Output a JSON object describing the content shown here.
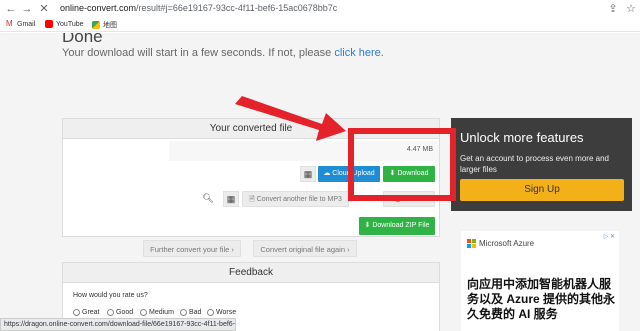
{
  "browser": {
    "url_host": "online-convert.com",
    "url_path": "/result#j=66e19167-93cc-4f11-bef6-15ac0678bb7c",
    "bookmarks": [
      {
        "label": "Gmail"
      },
      {
        "label": "YouTube"
      },
      {
        "label": "地图"
      }
    ]
  },
  "page": {
    "title": "Done",
    "subtitle_prefix": "Your download will start in a few seconds. If not, please ",
    "subtitle_link": "click here",
    "subtitle_suffix": "."
  },
  "converted": {
    "heading": "Your converted file",
    "file_size": "4.47 MB",
    "cloud_upload_label": "Cloud Upload",
    "download_label": "Download",
    "convert_another_label": "Convert another file to MP3",
    "delete_label": "Delete",
    "download_zip_label": "Download ZIP File"
  },
  "further": {
    "further_convert_label": "Further convert your file ›",
    "convert_original_label": "Convert original file again ›"
  },
  "feedback": {
    "heading": "Feedback",
    "question": "How would you rate us?",
    "options": [
      "Great",
      "Good",
      "Medium",
      "Bad",
      "Worse"
    ]
  },
  "promo": {
    "title": "Unlock more features",
    "description": "Get an account to process even more and larger files",
    "signup_label": "Sign Up"
  },
  "ad": {
    "brand": "Microsoft Azure",
    "text": "向应用中添加智能机器人服务以及 Azure 提供的其他永久免费的 AI 服务"
  },
  "status_bar": "https://dragon.online-convert.com/download-file/66e19167-93cc-4f11-bef6-...",
  "colors": {
    "accent_red": "#e4222a",
    "download_green": "#2fb344",
    "cloud_blue": "#1f8dd6",
    "signup_orange": "#f4b019",
    "promo_bg": "#3d3d3d"
  }
}
